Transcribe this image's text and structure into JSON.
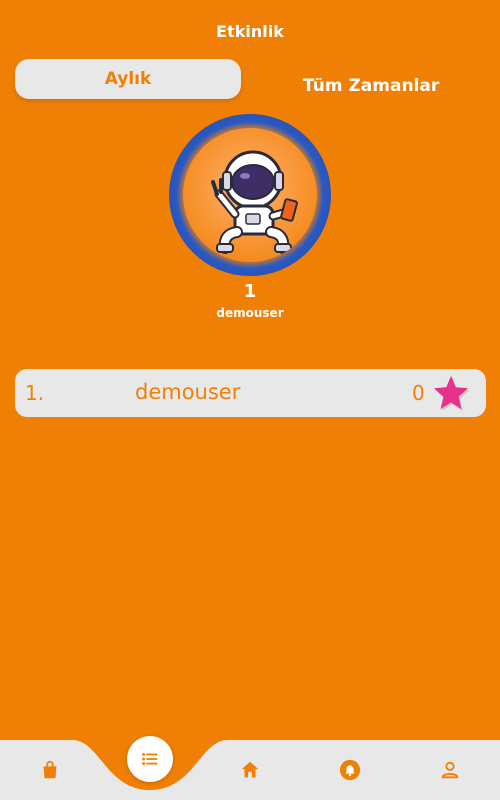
{
  "header": {
    "title": "Etkinlik"
  },
  "tabs": [
    {
      "label": "Aylık",
      "active": true
    },
    {
      "label": "Tüm Zamanlar",
      "active": false
    }
  ],
  "podium": {
    "rank": "1",
    "username": "demouser",
    "avatar": "astronaut-avatar"
  },
  "leaderboard": [
    {
      "rank": "1.",
      "username": "demouser",
      "score": "0",
      "icon": "star-icon"
    }
  ],
  "bottom_nav": {
    "items": [
      {
        "name": "shopping-bag-icon"
      },
      {
        "name": "list-icon",
        "active": true
      },
      {
        "name": "home-icon"
      },
      {
        "name": "notification-bell-icon"
      },
      {
        "name": "profile-icon"
      }
    ]
  },
  "colors": {
    "accent": "#ef8005",
    "surface": "#e8e8e8",
    "star": "#e8318a",
    "ring": "#1c3b8f"
  }
}
